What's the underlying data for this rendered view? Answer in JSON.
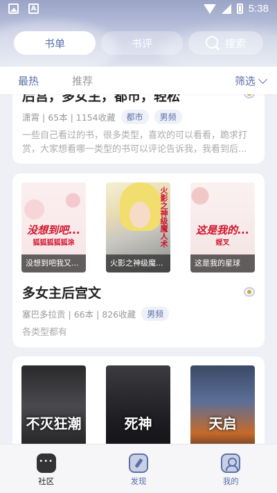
{
  "status_bar": {
    "time": "5:38",
    "icons": [
      "image-icon",
      "font-icon",
      "wifi-icon",
      "signal-icon",
      "battery-icon"
    ]
  },
  "top_tabs": [
    {
      "label": "书单",
      "active": true
    },
    {
      "label": "书评",
      "active": false
    }
  ],
  "search": {
    "label": "搜索",
    "icon": "search-icon"
  },
  "sub_nav": {
    "hot": "最热",
    "recommend": "推荐",
    "filter": "筛选",
    "filter_icon": "chevron-down-icon"
  },
  "cards": [
    {
      "title": "后宫，多女主，都市，轻松",
      "author": "潇霄",
      "count": "65本",
      "favorites": "1154收藏",
      "tags": [
        "都市",
        "男频"
      ],
      "description": "一些自己看过的书，很多类型，喜欢的可以看看，跪求打赏，大家想看哪一类型的书可以评论告诉我，我看到后..."
    },
    {
      "title": "多女主后宫文",
      "author": "塞巴多拉贡",
      "count": "66本",
      "favorites": "826收藏",
      "tags": [
        "男频"
      ],
      "description": "各类型都有",
      "covers": [
        {
          "caption": "没想到吧我又...",
          "cover_title": "没想到吧...",
          "cover_sub": "狐狐狐狐狐涂"
        },
        {
          "caption": "火影之神级魔...",
          "cover_title": "火影之神级魔人术",
          "cover_sub": ""
        },
        {
          "caption": "这是我的星球",
          "cover_title": "这是我的...",
          "cover_sub": "婬叉"
        }
      ]
    },
    {
      "covers": [
        {
          "cover_title": "不灭狂潮"
        },
        {
          "cover_title": "死神"
        },
        {
          "cover_title": "天启"
        }
      ]
    }
  ],
  "bottom_nav": [
    {
      "label": "社区",
      "icon": "chat-icon",
      "active": true
    },
    {
      "label": "发现",
      "icon": "compass-icon",
      "active": false
    },
    {
      "label": "我的",
      "icon": "user-icon",
      "active": false
    }
  ],
  "colors": {
    "accent": "#5a70a8",
    "background": "#eef0f6"
  }
}
